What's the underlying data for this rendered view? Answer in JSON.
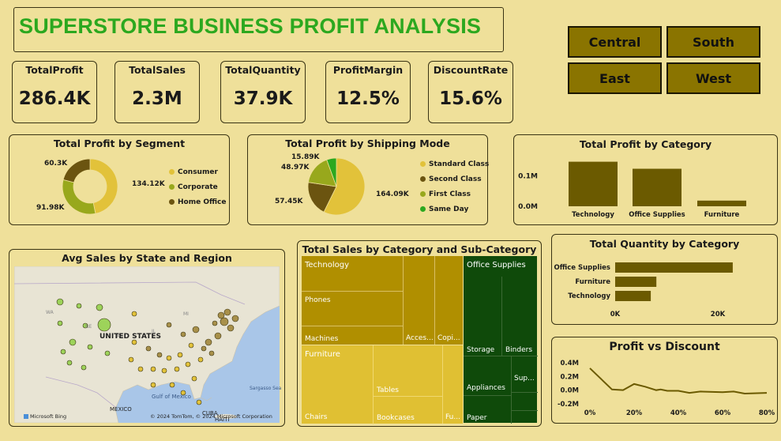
{
  "header": {
    "title": "SUPERSTORE BUSINESS PROFIT ANALYSIS"
  },
  "regions": [
    "Central",
    "South",
    "East",
    "West"
  ],
  "kpis": [
    {
      "label": "TotalProfit",
      "value": "286.4K"
    },
    {
      "label": "TotalSales",
      "value": "2.3M"
    },
    {
      "label": "TotalQuantity",
      "value": "37.9K"
    },
    {
      "label": "ProfitMargin",
      "value": "12.5%"
    },
    {
      "label": "DiscountRate",
      "value": "15.6%"
    }
  ],
  "colors": {
    "background": "#efe09a",
    "title_green": "#2ca81f",
    "region_fill": "#8a7400",
    "bar": "#6b5a00",
    "consumer": "#e2c23a",
    "corporate": "#98a81c",
    "home_office": "#6b5410",
    "standard": "#e2c23a",
    "second": "#6b5410",
    "first": "#98a81c",
    "sameday": "#2ca81f"
  },
  "chart_data": [
    {
      "id": "segment",
      "type": "pie",
      "title": "Total Profit by Segment",
      "labels": [
        "Consumer",
        "Corporate",
        "Home Office"
      ],
      "values": [
        134.12,
        91.98,
        60.3
      ],
      "data_labels": [
        "134.12K",
        "91.98K",
        "60.3K"
      ]
    },
    {
      "id": "shipping",
      "type": "pie",
      "title": "Total Profit by Shipping Mode",
      "labels": [
        "Standard Class",
        "Second Class",
        "First Class",
        "Same Day"
      ],
      "values": [
        164.09,
        57.45,
        48.97,
        15.89
      ],
      "data_labels": [
        "164.09K",
        "57.45K",
        "48.97K",
        "15.89K"
      ]
    },
    {
      "id": "category",
      "type": "bar",
      "title": "Total Profit by Category",
      "categories": [
        "Technology",
        "Office Supplies",
        "Furniture"
      ],
      "values": [
        145.5,
        122.5,
        18.5
      ],
      "yticks": [
        "0.0M",
        "0.1M"
      ]
    },
    {
      "id": "quantity",
      "type": "bar",
      "title": "Total Quantity by Category",
      "categories": [
        "Office Supplies",
        "Furniture",
        "Technology"
      ],
      "values": [
        22906,
        8028,
        6939
      ],
      "xticks": [
        "0K",
        "20K"
      ]
    },
    {
      "id": "treemap",
      "type": "heatmap",
      "title": "Total Sales by Category and Sub-Category",
      "groups": [
        {
          "name": "Technology",
          "children": [
            "Phones",
            "Machines",
            "Acces...",
            "Copi..."
          ]
        },
        {
          "name": "Furniture",
          "children": [
            "Chairs",
            "Tables",
            "Bookcases",
            "Fu..."
          ]
        },
        {
          "name": "Office Supplies",
          "children": [
            "Storage",
            "Binders",
            "Appliances",
            "Paper",
            "Sup..."
          ]
        }
      ]
    },
    {
      "id": "discount",
      "type": "line",
      "title": "Profit vs Discount",
      "x": [
        0,
        10,
        15,
        20,
        25,
        30,
        32,
        35,
        40,
        45,
        50,
        60,
        65,
        70,
        80
      ],
      "y": [
        0.32,
        0.01,
        0.0,
        0.09,
        0.05,
        0.0,
        0.01,
        -0.01,
        -0.01,
        -0.04,
        -0.02,
        -0.03,
        -0.02,
        -0.05,
        -0.04
      ],
      "xticks": [
        "0%",
        "20%",
        "40%",
        "60%",
        "80%"
      ],
      "yticks": [
        "0.4M",
        "0.2M",
        "0.0M",
        "-0.2M"
      ]
    }
  ],
  "map": {
    "title": "Avg Sales by State and Region",
    "country_label": "UNITED STATES",
    "place_labels": [
      "MEXICO",
      "CUBA",
      "HAITI",
      "Gulf of Mexico",
      "Sargasso Sea"
    ],
    "attribution": "© 2024 TomTom, © 2024 Microsoft Corporation",
    "provider": "Microsoft Bing"
  }
}
